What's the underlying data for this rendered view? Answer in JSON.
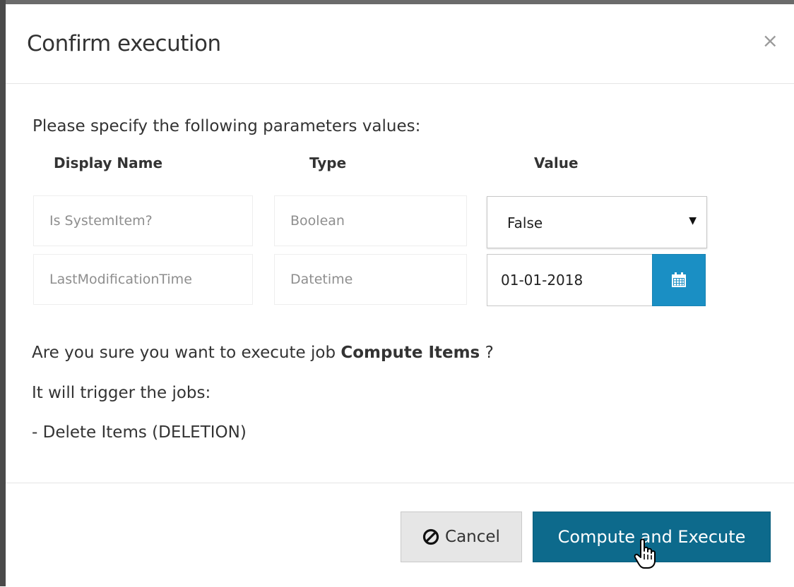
{
  "dialog": {
    "title": "Confirm execution",
    "close_label": "×"
  },
  "parameters": {
    "prompt": "Please specify the following parameters values:",
    "headers": {
      "display_name": "Display Name",
      "type": "Type",
      "value": "Value"
    },
    "rows": [
      {
        "display_name": "Is SystemItem?",
        "type": "Boolean",
        "value": "False"
      },
      {
        "display_name": "LastModificationTime",
        "type": "Datetime",
        "value": "01-01-2018"
      }
    ]
  },
  "confirmation": {
    "prefix": "Are you sure you want to execute job",
    "job_name": "Compute Items",
    "suffix": "?",
    "trigger_text": "It will trigger the jobs:",
    "triggered_jobs": [
      "- Delete Items (DELETION)"
    ]
  },
  "footer": {
    "cancel_label": "Cancel",
    "execute_label": "Compute and Execute"
  },
  "icons": {
    "close": "close-icon",
    "select_arrow": "caret-down-icon",
    "calendar": "calendar-icon",
    "cancel": "ban-icon",
    "cursor": "hand-pointer-cursor-icon"
  },
  "colors": {
    "calendar_button": "#1a8fc4",
    "execute_button": "#0d6a8c",
    "cancel_button": "#e6e6e6",
    "page_edge": "#4a4a4a"
  }
}
